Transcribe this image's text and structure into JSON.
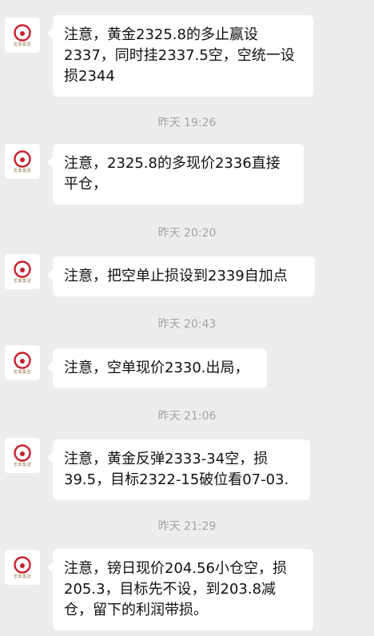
{
  "sender": {
    "avatar_icon": "red-crescent-logo-icon",
    "avatar_text": "宏鼎集团",
    "brand_color": "#c8202c"
  },
  "messages": [
    {
      "text": "注意，黄金2325.8的多止赢设\n2337，同时挂2337.5空，空统一设\n损2344"
    },
    {
      "time": "昨天 19:26",
      "text": "注意，2325.8的多现价2336直接\n平仓，"
    },
    {
      "time": "昨天 20:20",
      "text": "注意，把空单止损设到2339自加点"
    },
    {
      "time": "昨天 20:43",
      "text": "注意，空单现价2330.出局，"
    },
    {
      "time": "昨天 21:06",
      "text": "注意，黄金反弹2333-34空，损\n39.5，目标2322-15破位看07-03."
    },
    {
      "time": "昨天 21:29",
      "text": "注意，镑日现价204.56小仓空，损\n205.3，目标先不设，到203.8减\n仓，留下的利润带损。"
    }
  ]
}
